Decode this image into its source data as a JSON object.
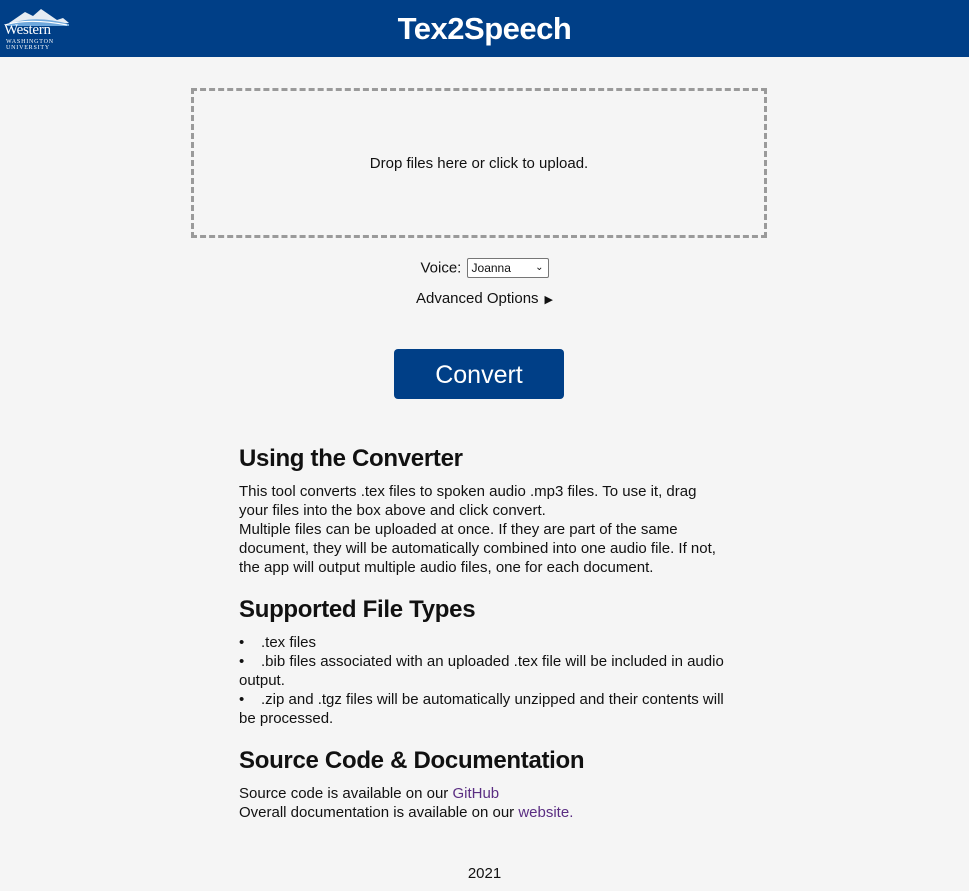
{
  "header": {
    "logo": {
      "line1": "Western",
      "line2": "WASHINGTON",
      "line3": "UNIVERSITY"
    },
    "title": "Tex2Speech"
  },
  "upload": {
    "dropzone_text": "Drop files here or click to upload."
  },
  "voice": {
    "label": "Voice:",
    "selected": "Joanna"
  },
  "advanced": {
    "label": "Advanced Options"
  },
  "convert": {
    "label": "Convert"
  },
  "sections": {
    "using": {
      "heading": "Using the Converter",
      "para1": "This tool converts .tex files to spoken audio .mp3 files. To use it, drag your files into the box above and click convert.",
      "para2": "Multiple files can be uploaded at once. If they are part of the same document, they will be automatically combined into one audio file. If not, the app will output multiple audio files, one for each document."
    },
    "types": {
      "heading": "Supported File Types",
      "items": [
        ".tex files",
        ".bib files associated with an uploaded .tex file will be included in audio output.",
        ".zip and .tgz files will be automatically unzipped and their contents will be processed."
      ]
    },
    "source": {
      "heading": "Source Code & Documentation",
      "line1_prefix": "Source code is available on our ",
      "line1_link": "GitHub",
      "line2_prefix": "Overall documentation is available on our ",
      "line2_link": "website",
      "line2_suffix": "."
    }
  },
  "footer": {
    "year": "2021"
  },
  "colors": {
    "brand": "#003f87",
    "link": "#5a2d82",
    "background": "#f5f5f5"
  }
}
